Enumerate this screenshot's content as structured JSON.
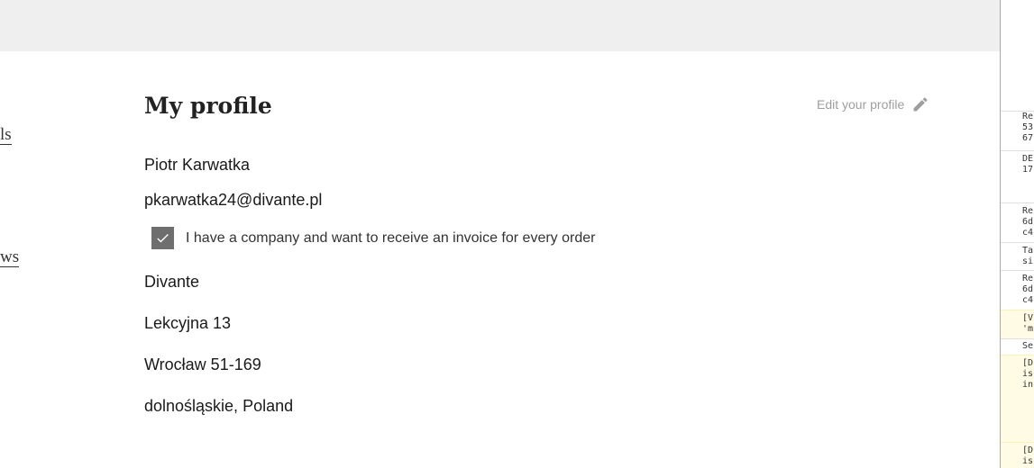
{
  "left_nav": {
    "item_a": "ls",
    "item_b": "ws"
  },
  "profile": {
    "title": "My profile",
    "edit_label": "Edit your profile",
    "edit_icon": "pencil-icon",
    "name": "Piotr Karwatka",
    "email": "pkarwatka24@divante.pl",
    "company_checkbox": {
      "checked": true,
      "label": "I have a company and want to receive an invoice for every order"
    },
    "company": "Divante",
    "street": "Lekcyjna 13",
    "city_zip": "Wrocław 51-169",
    "region_country": "dolnośląskie, Poland"
  },
  "console": {
    "entries": [
      {
        "lines": [
          "Re",
          "53",
          "67"
        ],
        "level": "log"
      },
      {
        "lines": [
          "DE",
          "17"
        ],
        "level": "log"
      },
      {
        "lines": [
          "Re",
          "6d",
          "c4"
        ],
        "level": "log"
      },
      {
        "lines": [
          "Ta",
          "si"
        ],
        "level": "log"
      },
      {
        "lines": [
          "Re",
          "6d",
          "c4"
        ],
        "level": "log"
      },
      {
        "lines": [
          "[V",
          "'m"
        ],
        "level": "warn"
      },
      {
        "lines": [
          "Se"
        ],
        "level": "log"
      },
      {
        "lines": [
          "[D",
          "is",
          "in"
        ],
        "level": "warn"
      },
      {
        "lines": [
          "[D",
          "is"
        ],
        "level": "warn"
      }
    ]
  },
  "colors": {
    "topbar": "#efefef",
    "checkbox": "#6e6e6e",
    "muted_text": "#9e9e9e",
    "warn_bg": "#fffbe5"
  }
}
